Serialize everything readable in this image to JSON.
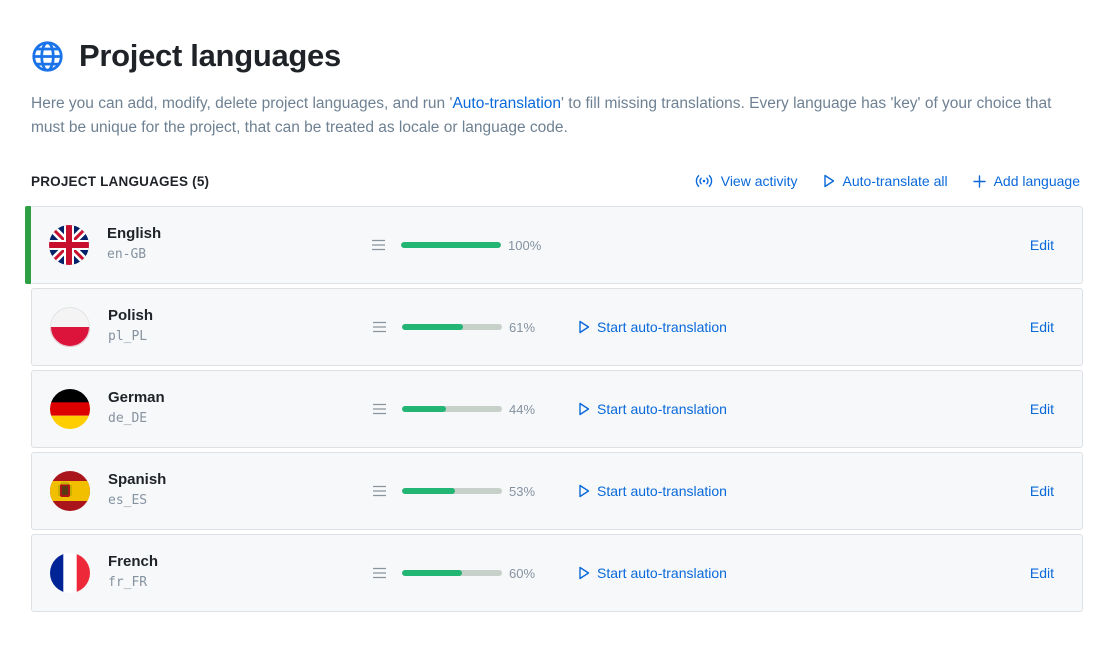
{
  "header": {
    "title": "Project languages",
    "icon": "globe-icon"
  },
  "description": {
    "before": "Here you can add, modify, delete project languages, and run '",
    "link": "Auto-translation",
    "after": "' to fill missing translations. Every language has 'key' of your choice that must be unique for the project, that can be treated as locale or language code."
  },
  "section": {
    "title": "PROJECT LANGUAGES (5)",
    "view_activity": "View activity",
    "auto_translate_all": "Auto-translate all",
    "add_language": "Add language"
  },
  "languages": [
    {
      "name": "English",
      "tag": "en-GB",
      "progress": 100,
      "progress_label": "100%",
      "auto_label": "",
      "edit_label": "Edit",
      "flag": "uk-flag"
    },
    {
      "name": "Polish",
      "tag": "pl_PL",
      "progress": 61,
      "progress_label": "61%",
      "auto_label": "Start auto-translation",
      "edit_label": "Edit",
      "flag": "pl-flag"
    },
    {
      "name": "German",
      "tag": "de_DE",
      "progress": 44,
      "progress_label": "44%",
      "auto_label": "Start auto-translation",
      "edit_label": "Edit",
      "flag": "de-flag"
    },
    {
      "name": "Spanish",
      "tag": "es_ES",
      "progress": 53,
      "progress_label": "53%",
      "auto_label": "Start auto-translation",
      "edit_label": "Edit",
      "flag": "es-flag"
    },
    {
      "name": "French",
      "tag": "fr_FR",
      "progress": 60,
      "progress_label": "60%",
      "auto_label": "Start auto-translation",
      "edit_label": "Edit",
      "flag": "fr-flag"
    }
  ],
  "colors": {
    "accent": "#0969da",
    "progress": "#22b573",
    "base_marker": "#2ea043"
  }
}
